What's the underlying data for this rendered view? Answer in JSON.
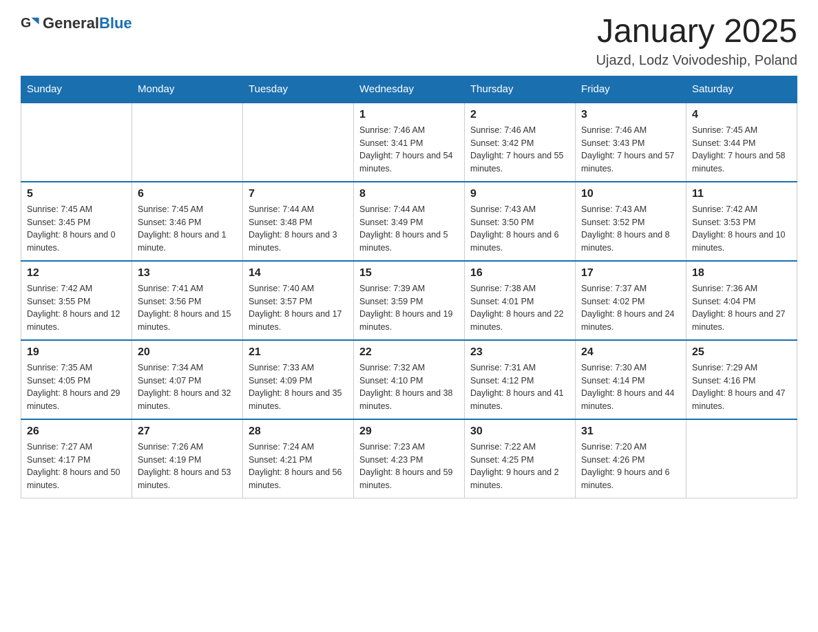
{
  "header": {
    "logo_general": "General",
    "logo_blue": "Blue",
    "title": "January 2025",
    "subtitle": "Ujazd, Lodz Voivodeship, Poland"
  },
  "days_of_week": [
    "Sunday",
    "Monday",
    "Tuesday",
    "Wednesday",
    "Thursday",
    "Friday",
    "Saturday"
  ],
  "weeks": [
    [
      {
        "day": "",
        "info": ""
      },
      {
        "day": "",
        "info": ""
      },
      {
        "day": "",
        "info": ""
      },
      {
        "day": "1",
        "info": "Sunrise: 7:46 AM\nSunset: 3:41 PM\nDaylight: 7 hours and 54 minutes."
      },
      {
        "day": "2",
        "info": "Sunrise: 7:46 AM\nSunset: 3:42 PM\nDaylight: 7 hours and 55 minutes."
      },
      {
        "day": "3",
        "info": "Sunrise: 7:46 AM\nSunset: 3:43 PM\nDaylight: 7 hours and 57 minutes."
      },
      {
        "day": "4",
        "info": "Sunrise: 7:45 AM\nSunset: 3:44 PM\nDaylight: 7 hours and 58 minutes."
      }
    ],
    [
      {
        "day": "5",
        "info": "Sunrise: 7:45 AM\nSunset: 3:45 PM\nDaylight: 8 hours and 0 minutes."
      },
      {
        "day": "6",
        "info": "Sunrise: 7:45 AM\nSunset: 3:46 PM\nDaylight: 8 hours and 1 minute."
      },
      {
        "day": "7",
        "info": "Sunrise: 7:44 AM\nSunset: 3:48 PM\nDaylight: 8 hours and 3 minutes."
      },
      {
        "day": "8",
        "info": "Sunrise: 7:44 AM\nSunset: 3:49 PM\nDaylight: 8 hours and 5 minutes."
      },
      {
        "day": "9",
        "info": "Sunrise: 7:43 AM\nSunset: 3:50 PM\nDaylight: 8 hours and 6 minutes."
      },
      {
        "day": "10",
        "info": "Sunrise: 7:43 AM\nSunset: 3:52 PM\nDaylight: 8 hours and 8 minutes."
      },
      {
        "day": "11",
        "info": "Sunrise: 7:42 AM\nSunset: 3:53 PM\nDaylight: 8 hours and 10 minutes."
      }
    ],
    [
      {
        "day": "12",
        "info": "Sunrise: 7:42 AM\nSunset: 3:55 PM\nDaylight: 8 hours and 12 minutes."
      },
      {
        "day": "13",
        "info": "Sunrise: 7:41 AM\nSunset: 3:56 PM\nDaylight: 8 hours and 15 minutes."
      },
      {
        "day": "14",
        "info": "Sunrise: 7:40 AM\nSunset: 3:57 PM\nDaylight: 8 hours and 17 minutes."
      },
      {
        "day": "15",
        "info": "Sunrise: 7:39 AM\nSunset: 3:59 PM\nDaylight: 8 hours and 19 minutes."
      },
      {
        "day": "16",
        "info": "Sunrise: 7:38 AM\nSunset: 4:01 PM\nDaylight: 8 hours and 22 minutes."
      },
      {
        "day": "17",
        "info": "Sunrise: 7:37 AM\nSunset: 4:02 PM\nDaylight: 8 hours and 24 minutes."
      },
      {
        "day": "18",
        "info": "Sunrise: 7:36 AM\nSunset: 4:04 PM\nDaylight: 8 hours and 27 minutes."
      }
    ],
    [
      {
        "day": "19",
        "info": "Sunrise: 7:35 AM\nSunset: 4:05 PM\nDaylight: 8 hours and 29 minutes."
      },
      {
        "day": "20",
        "info": "Sunrise: 7:34 AM\nSunset: 4:07 PM\nDaylight: 8 hours and 32 minutes."
      },
      {
        "day": "21",
        "info": "Sunrise: 7:33 AM\nSunset: 4:09 PM\nDaylight: 8 hours and 35 minutes."
      },
      {
        "day": "22",
        "info": "Sunrise: 7:32 AM\nSunset: 4:10 PM\nDaylight: 8 hours and 38 minutes."
      },
      {
        "day": "23",
        "info": "Sunrise: 7:31 AM\nSunset: 4:12 PM\nDaylight: 8 hours and 41 minutes."
      },
      {
        "day": "24",
        "info": "Sunrise: 7:30 AM\nSunset: 4:14 PM\nDaylight: 8 hours and 44 minutes."
      },
      {
        "day": "25",
        "info": "Sunrise: 7:29 AM\nSunset: 4:16 PM\nDaylight: 8 hours and 47 minutes."
      }
    ],
    [
      {
        "day": "26",
        "info": "Sunrise: 7:27 AM\nSunset: 4:17 PM\nDaylight: 8 hours and 50 minutes."
      },
      {
        "day": "27",
        "info": "Sunrise: 7:26 AM\nSunset: 4:19 PM\nDaylight: 8 hours and 53 minutes."
      },
      {
        "day": "28",
        "info": "Sunrise: 7:24 AM\nSunset: 4:21 PM\nDaylight: 8 hours and 56 minutes."
      },
      {
        "day": "29",
        "info": "Sunrise: 7:23 AM\nSunset: 4:23 PM\nDaylight: 8 hours and 59 minutes."
      },
      {
        "day": "30",
        "info": "Sunrise: 7:22 AM\nSunset: 4:25 PM\nDaylight: 9 hours and 2 minutes."
      },
      {
        "day": "31",
        "info": "Sunrise: 7:20 AM\nSunset: 4:26 PM\nDaylight: 9 hours and 6 minutes."
      },
      {
        "day": "",
        "info": ""
      }
    ]
  ]
}
